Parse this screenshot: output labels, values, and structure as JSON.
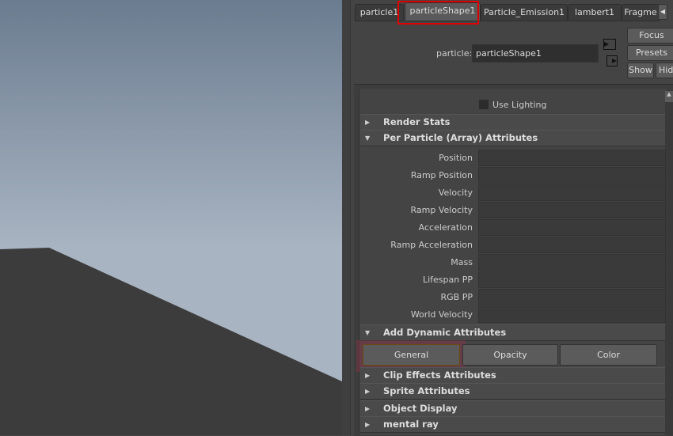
{
  "tabs": [
    {
      "label": "particle1"
    },
    {
      "label": "particleShape1"
    },
    {
      "label": "Particle_Emission1"
    },
    {
      "label": "lambert1"
    },
    {
      "label": "Fragme"
    }
  ],
  "header": {
    "node_label": "particle:",
    "node_value": "particleShape1",
    "focus": "Focus",
    "presets": "Presets",
    "show": "Show",
    "hide": "Hide"
  },
  "use_lighting": "Use Lighting",
  "sections": {
    "render_stats": "Render Stats",
    "per_particle": "Per Particle (Array) Attributes",
    "add_dynamic": "Add Dynamic Attributes",
    "clip": "Clip Effects Attributes",
    "sprite": "Sprite Attributes",
    "object_display": "Object Display",
    "mental_ray": "mental ray"
  },
  "attributes": [
    "Position",
    "Ramp Position",
    "Velocity",
    "Ramp Velocity",
    "Acceleration",
    "Ramp Acceleration",
    "Mass",
    "Lifespan PP",
    "RGB PP",
    "World Velocity"
  ],
  "dynamic_buttons": {
    "general": "General",
    "opacity": "Opacity",
    "color": "Color"
  },
  "highlight_color": "#e00000"
}
